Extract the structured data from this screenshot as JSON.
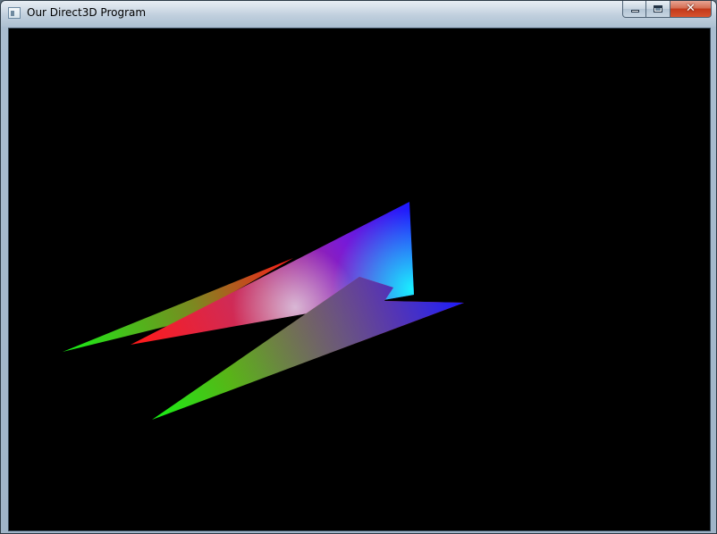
{
  "window": {
    "title": "Our Direct3D Program"
  },
  "icons": {
    "app": "application-window-icon",
    "minimize": "minimize-icon",
    "maximize": "maximize-icon",
    "close": "close-icon"
  },
  "scene": {
    "background": "#000000",
    "vertex_colors": {
      "red": "#ff1a1a",
      "green": "#16f016",
      "blue": "#1a1aff",
      "cyan": "#19f2ff",
      "magenta": "#b000ff"
    }
  }
}
